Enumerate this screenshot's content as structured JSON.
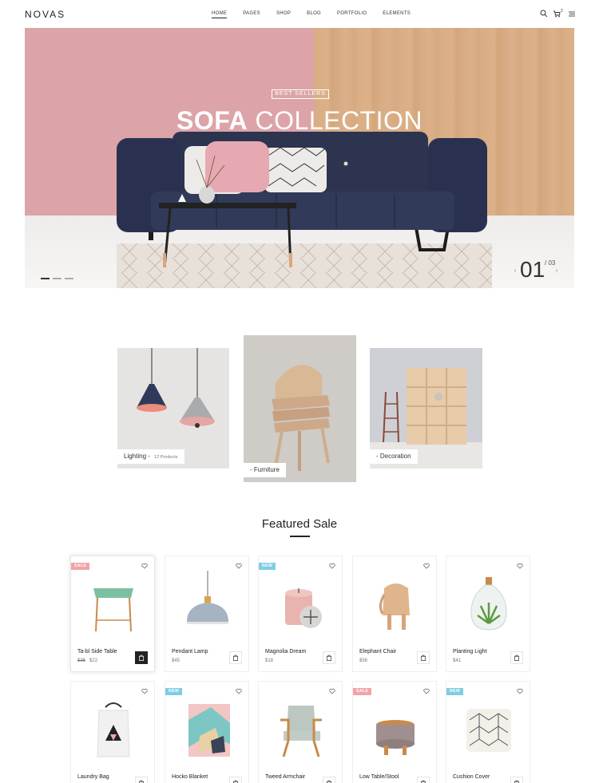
{
  "header": {
    "logo": "NOVAS",
    "nav": [
      "HOME",
      "PAGES",
      "SHOP",
      "BLOG",
      "PORTFOLIO",
      "ELEMENTS"
    ],
    "cart_count": "2"
  },
  "hero": {
    "badge": "BEST SELLERS",
    "title_bold": "SOFA",
    "title_rest": " COLLECTION",
    "slide_current": "01",
    "slide_total": "/ 03",
    "prev_arrow": "‹",
    "next_arrow": "›"
  },
  "categories": [
    {
      "name": "Lighting",
      "sep": " - ",
      "count": "12 Products"
    },
    {
      "name": "- Furniture"
    },
    {
      "name": "- Decoration"
    }
  ],
  "featured": {
    "title": "Featured Sale",
    "products": [
      {
        "name": "Ta-bl Side Table",
        "old_price": "$35",
        "price": "$22",
        "badge": "SALE"
      },
      {
        "name": "Pendant Lamp",
        "price": "$45"
      },
      {
        "name": "Magnolia Dream",
        "price": "$18",
        "badge": "NEW"
      },
      {
        "name": "Elephant Chair",
        "price": "$56"
      },
      {
        "name": "Planting Light",
        "price": "$41"
      },
      {
        "name": "Laundry Bag"
      },
      {
        "name": "Hocko Blanket",
        "badge": "NEW"
      },
      {
        "name": "Tweed Armchair"
      },
      {
        "name": "Low Table/Stool",
        "badge": "SALE"
      },
      {
        "name": "Cushion Cover",
        "badge": "NEW"
      }
    ]
  },
  "colors": {
    "sale": "#f1a3a8",
    "new": "#7fcde3",
    "hero_pink": "#dca4a8",
    "sofa": "#2c3450"
  }
}
